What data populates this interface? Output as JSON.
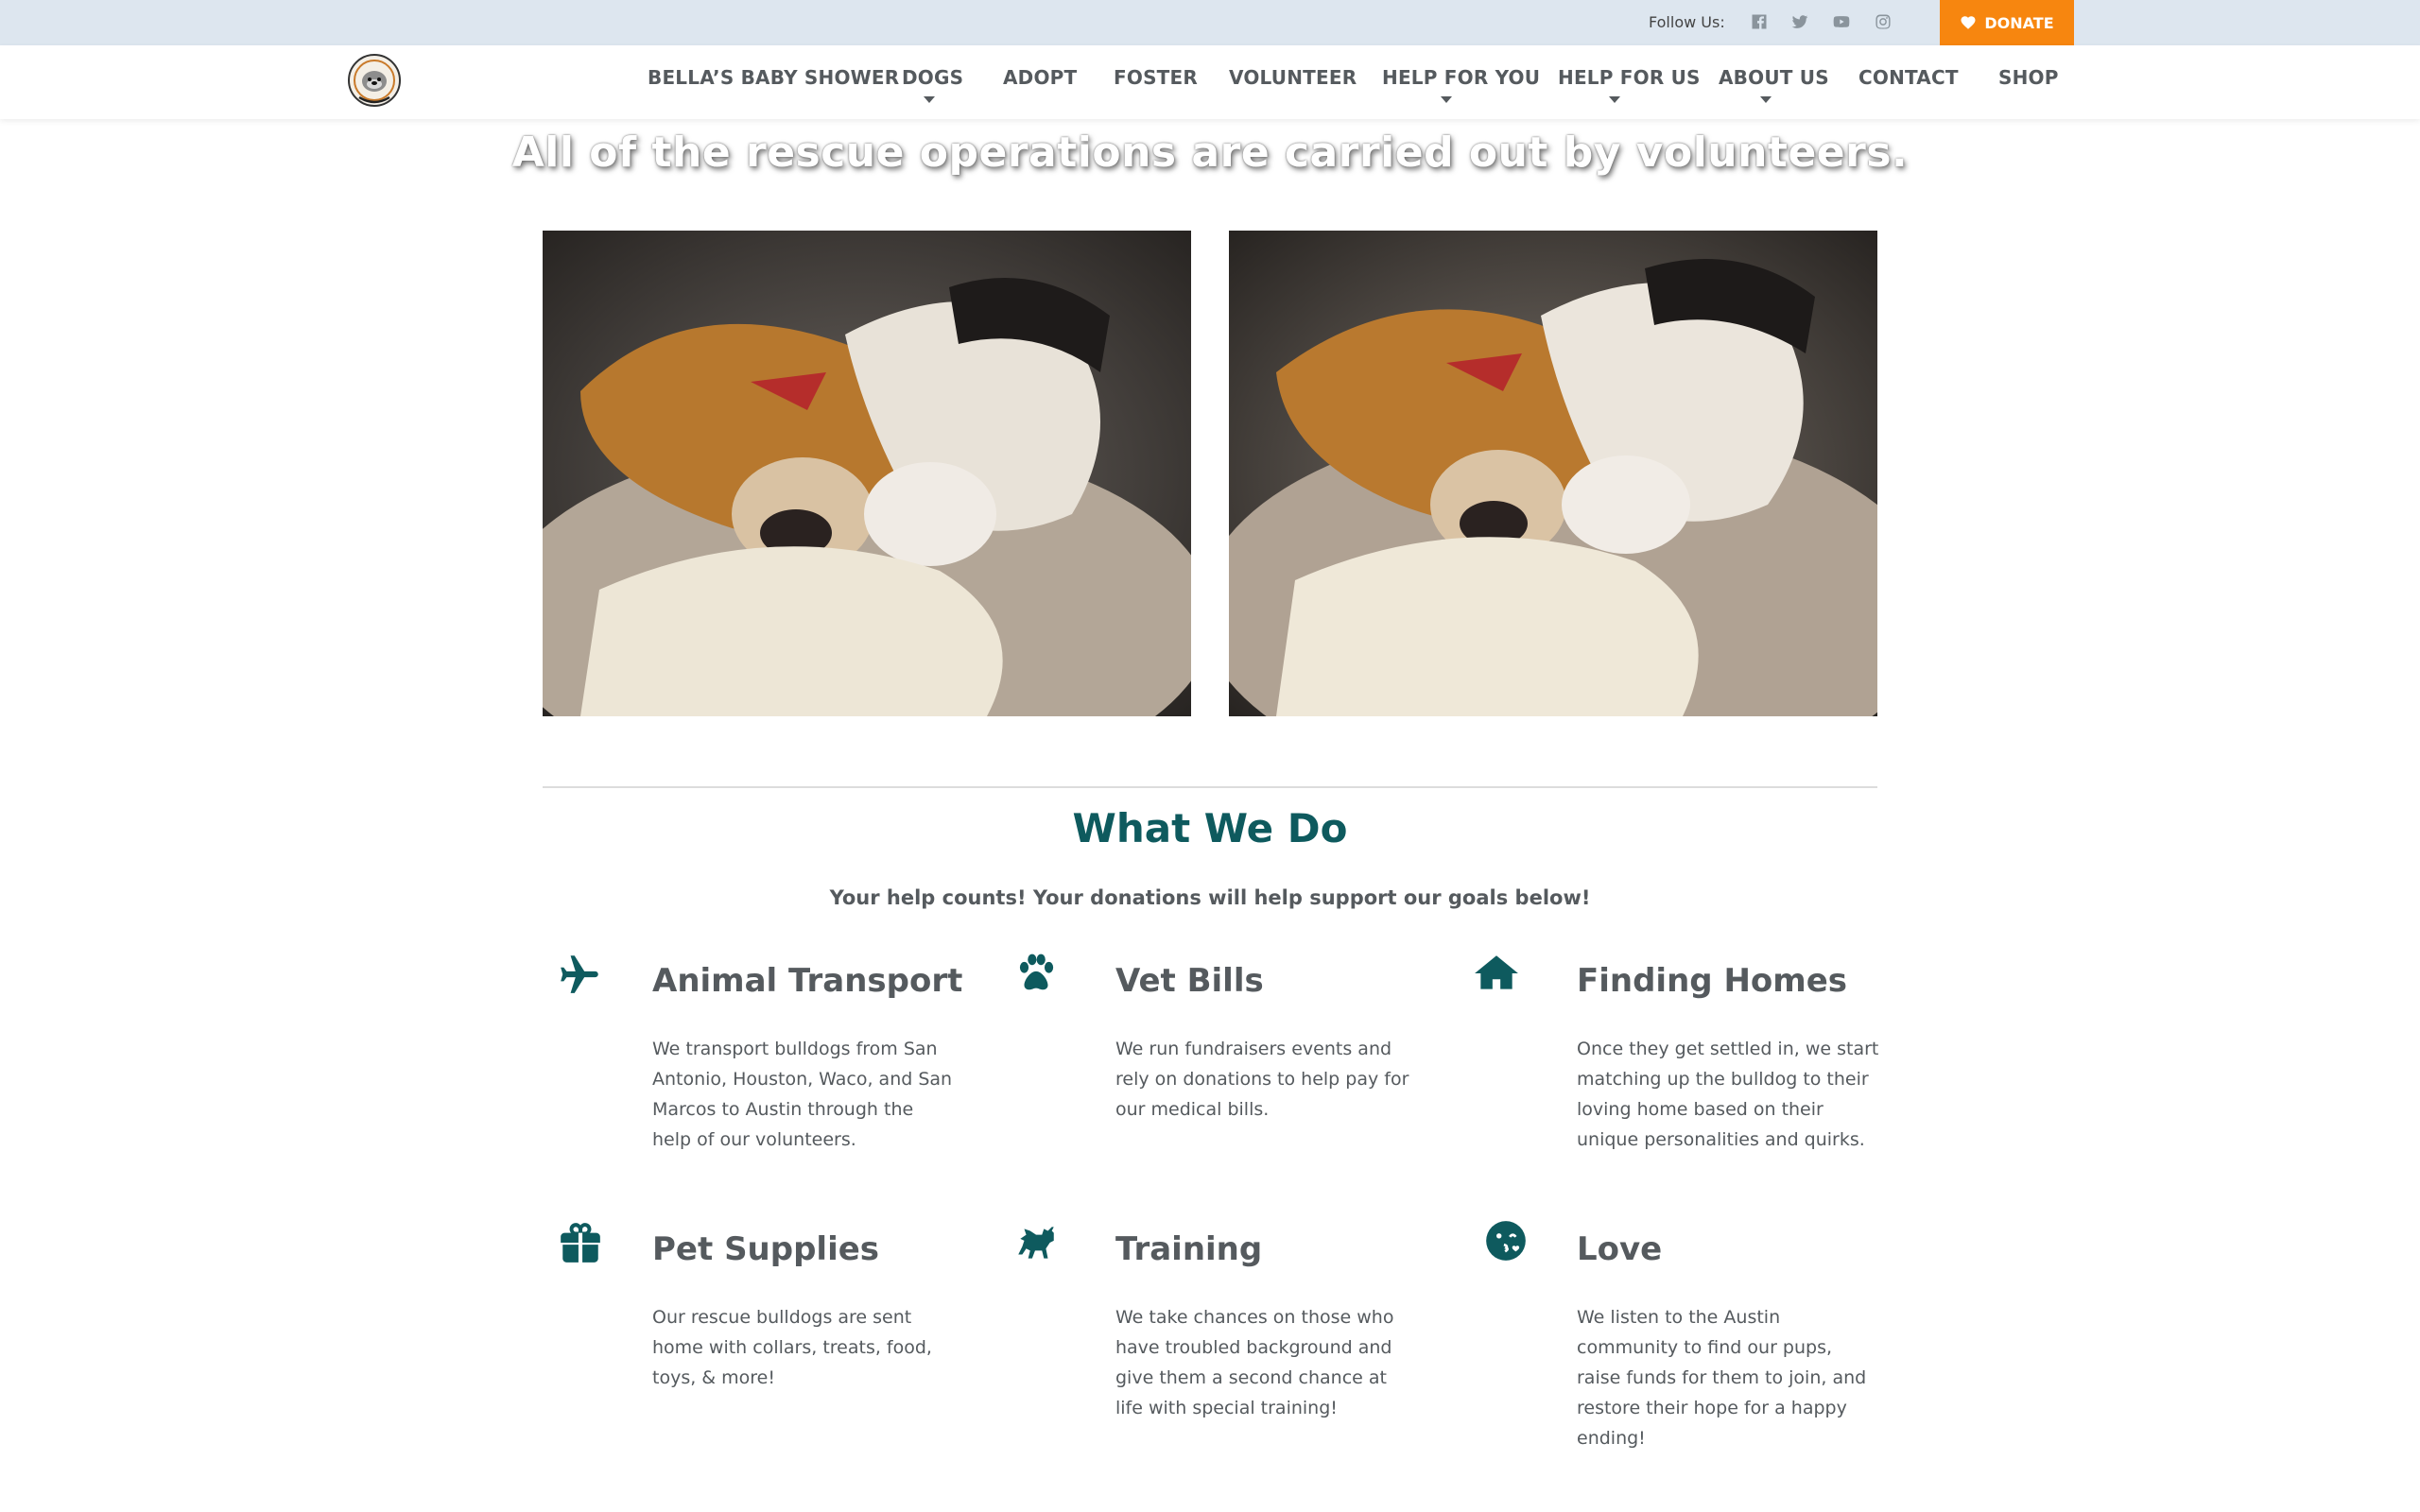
{
  "topbar": {
    "follow_label": "Follow Us:",
    "social_icons": [
      "facebook-icon",
      "twitter-icon",
      "youtube-icon",
      "instagram-icon"
    ],
    "donate_label": "DONATE",
    "donate_color": "#f7860f",
    "bar_color": "#dde6ef"
  },
  "nav": {
    "items": [
      {
        "label": "BELLA’S BABY SHOWER",
        "has_dropdown": false
      },
      {
        "label": "DOGS",
        "has_dropdown": true
      },
      {
        "label": "ADOPT",
        "has_dropdown": false
      },
      {
        "label": "FOSTER",
        "has_dropdown": false
      },
      {
        "label": "VOLUNTEER",
        "has_dropdown": false
      },
      {
        "label": "HELP FOR YOU",
        "has_dropdown": true
      },
      {
        "label": "HELP FOR US",
        "has_dropdown": true
      },
      {
        "label": "ABOUT US",
        "has_dropdown": true
      },
      {
        "label": "CONTACT",
        "has_dropdown": false
      },
      {
        "label": "SHOP",
        "has_dropdown": false
      }
    ]
  },
  "hero": {
    "headline": "All of the rescue operations are carried out by volunteers."
  },
  "what_we_do": {
    "title": "What We Do",
    "subtitle": "Your help counts! Your donations will help support our goals below!",
    "accent_color": "#0e5a5e",
    "features": [
      {
        "icon": "plane-icon",
        "title": "Animal Transport",
        "text": "We transport bulldogs from San Antonio, Houston, Waco, and San Marcos to Austin through the help of our volunteers."
      },
      {
        "icon": "paw-icon",
        "title": "Vet Bills",
        "text": "We run fundraisers events and rely on donations to help pay for our medical bills."
      },
      {
        "icon": "home-icon",
        "title": "Finding Homes",
        "text": "Once they get settled in, we start matching up the bulldog to their loving home based on their unique personalities and quirks."
      },
      {
        "icon": "gift-icon",
        "title": "Pet Supplies",
        "text": "Our rescue bulldogs are sent home with collars, treats, food, toys, & more!"
      },
      {
        "icon": "dog-training-icon",
        "title": "Training",
        "text": "We take chances on those who have troubled background and give them a second chance at life with special training!"
      },
      {
        "icon": "kiss-face-icon",
        "title": "Love",
        "text": "We listen to the Austin community to find our pups, raise funds for them to join, and restore their hope for a happy ending!"
      }
    ]
  }
}
